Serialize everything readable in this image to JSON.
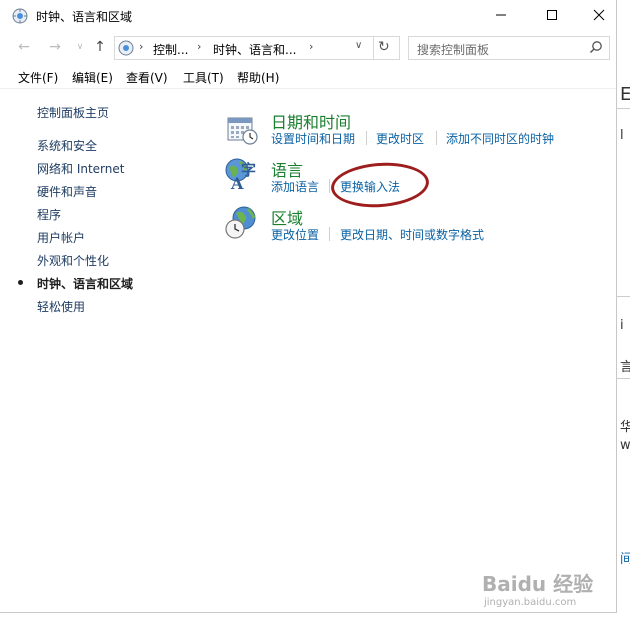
{
  "window": {
    "title": "时钟、语言和区域",
    "controls": {
      "minimize": "—",
      "maximize": "☐",
      "close": "✕"
    }
  },
  "nav": {
    "back": "←",
    "forward": "→",
    "dropdown": "∨",
    "up": "↑",
    "breadcrumbs": [
      "控制...",
      "时钟、语言和..."
    ],
    "separator": "›",
    "address_dropdown": "∨",
    "refresh": "↻",
    "search_placeholder": "搜索控制面板"
  },
  "menu": [
    "文件(F)",
    "编辑(E)",
    "查看(V)",
    "工具(T)",
    "帮助(H)"
  ],
  "sidebar": {
    "home": "控制面板主页",
    "items": [
      {
        "label": "系统和安全",
        "active": false
      },
      {
        "label": "网络和 Internet",
        "active": false
      },
      {
        "label": "硬件和声音",
        "active": false
      },
      {
        "label": "程序",
        "active": false
      },
      {
        "label": "用户帐户",
        "active": false
      },
      {
        "label": "外观和个性化",
        "active": false
      },
      {
        "label": "时钟、语言和区域",
        "active": true
      },
      {
        "label": "轻松使用",
        "active": false
      }
    ]
  },
  "categories": [
    {
      "title": "日期和时间",
      "icon": "calendar-clock-icon",
      "links": [
        "设置时间和日期",
        "更改时区",
        "添加不同时区的时钟"
      ]
    },
    {
      "title": "语言",
      "icon": "language-icon",
      "links": [
        "添加语言",
        "更换输入法"
      ]
    },
    {
      "title": "区域",
      "icon": "globe-clock-icon",
      "links": [
        "更改位置",
        "更改日期、时间或数字格式"
      ]
    }
  ],
  "background_fragments": [
    "E",
    "l",
    "i",
    "言",
    "华",
    "w",
    "间"
  ],
  "watermark": {
    "brand": "Baidu 经验",
    "url": "jingyan.baidu.com"
  },
  "colors": {
    "link": "#0b62a4",
    "category_title": "#1a7f2f",
    "sidebar": "#1f3d63",
    "annotation": "#9e1e1e"
  }
}
